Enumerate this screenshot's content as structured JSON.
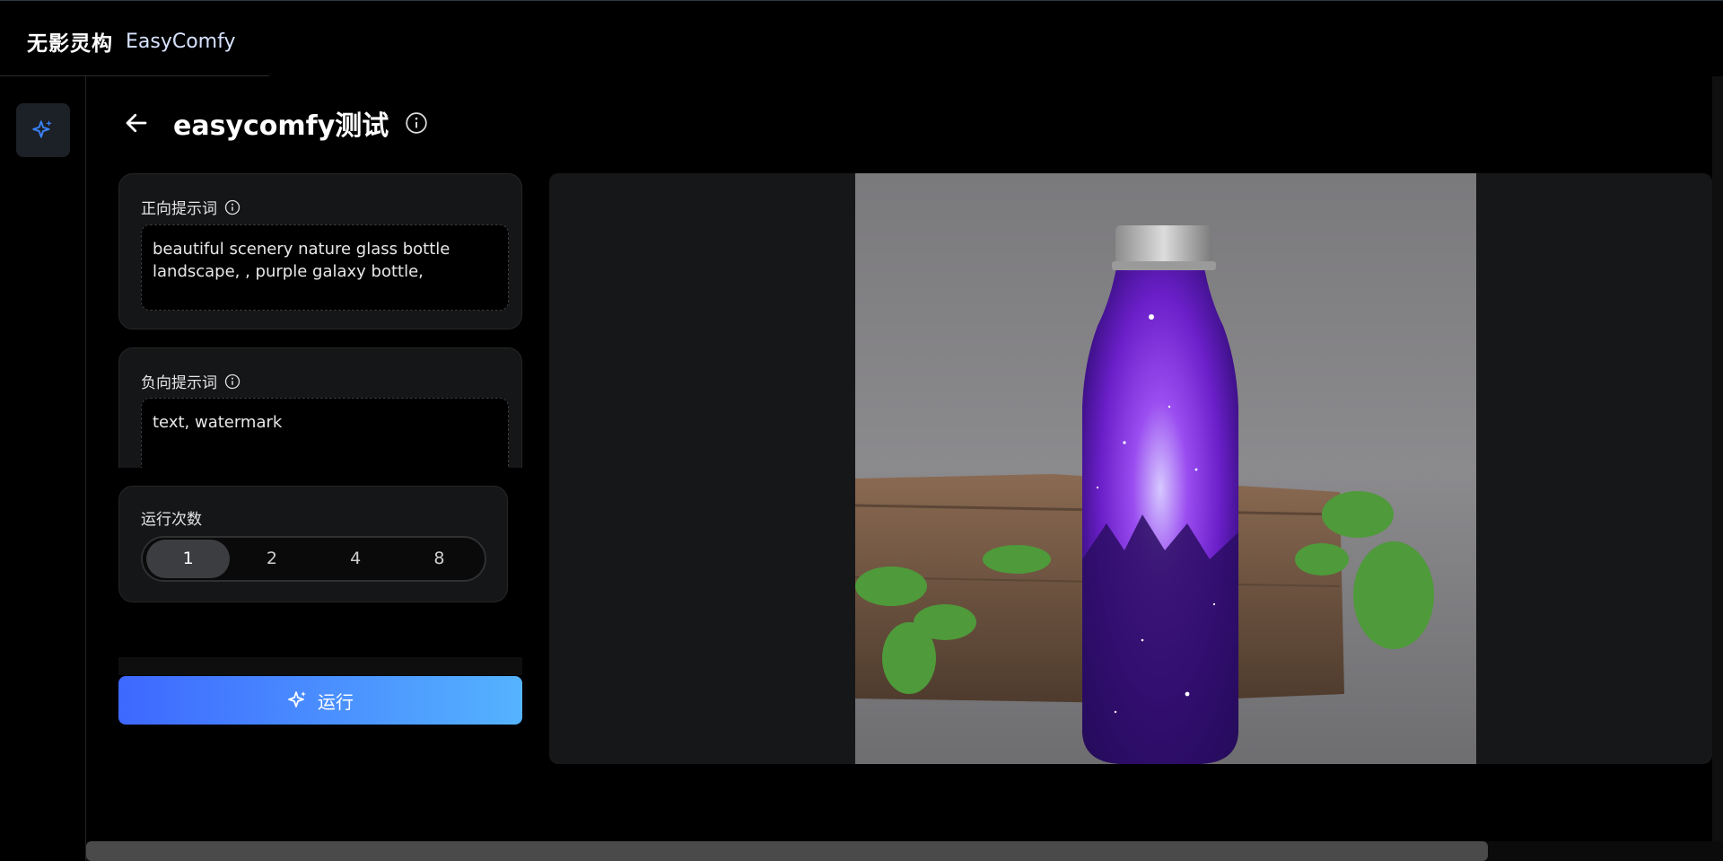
{
  "brand": {
    "name_cn": "无影灵构",
    "name_en": "EasyComfy"
  },
  "page": {
    "title": "easycomfy测试"
  },
  "positive": {
    "label": "正向提示词",
    "value": "beautiful scenery nature glass bottle landscape, , purple galaxy bottle,"
  },
  "negative": {
    "label": "负向提示词",
    "value": "text, watermark"
  },
  "runs": {
    "label": "运行次数",
    "options": [
      "1",
      "2",
      "4",
      "8"
    ],
    "selected": "1"
  },
  "run_button": {
    "label": "运行"
  },
  "colors": {
    "accent_start": "#3e68ff",
    "accent_end": "#55b3ff",
    "rail_icon": "#3b82f6"
  },
  "icons": [
    "sparkle-icon",
    "back-arrow-icon",
    "info-icon"
  ]
}
